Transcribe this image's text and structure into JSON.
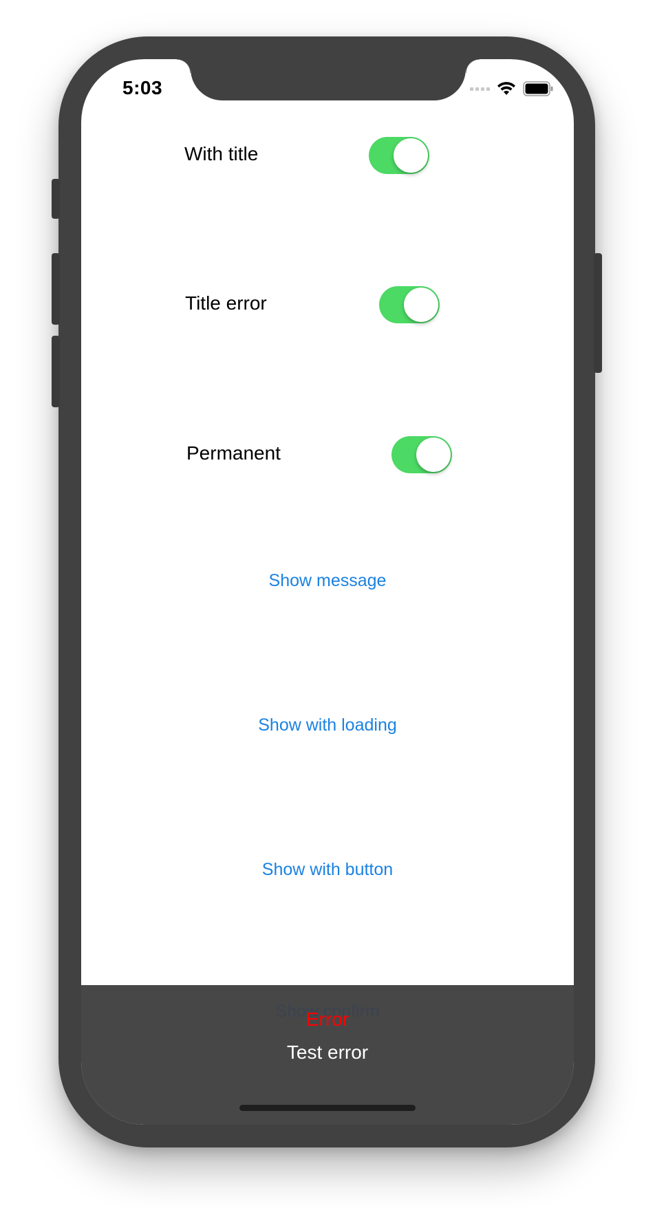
{
  "status_bar": {
    "time": "5:03",
    "icons": [
      "cellular-signal-icon",
      "wifi-icon",
      "battery-icon"
    ]
  },
  "settings": [
    {
      "label": "With title",
      "on": true
    },
    {
      "label": "Title error",
      "on": true
    },
    {
      "label": "Permanent",
      "on": true
    }
  ],
  "buttons": {
    "show_message": "Show message",
    "show_with_loading": "Show with loading",
    "show_with_button": "Show with button",
    "show_confirm": "Show confirm"
  },
  "toast": {
    "title": "Error",
    "message": "Test error"
  },
  "colors": {
    "accent": "#1a82e2",
    "switch_on": "#4cd964",
    "error": "#ff0000",
    "toast_bg": "#474747",
    "frame": "#414141"
  }
}
